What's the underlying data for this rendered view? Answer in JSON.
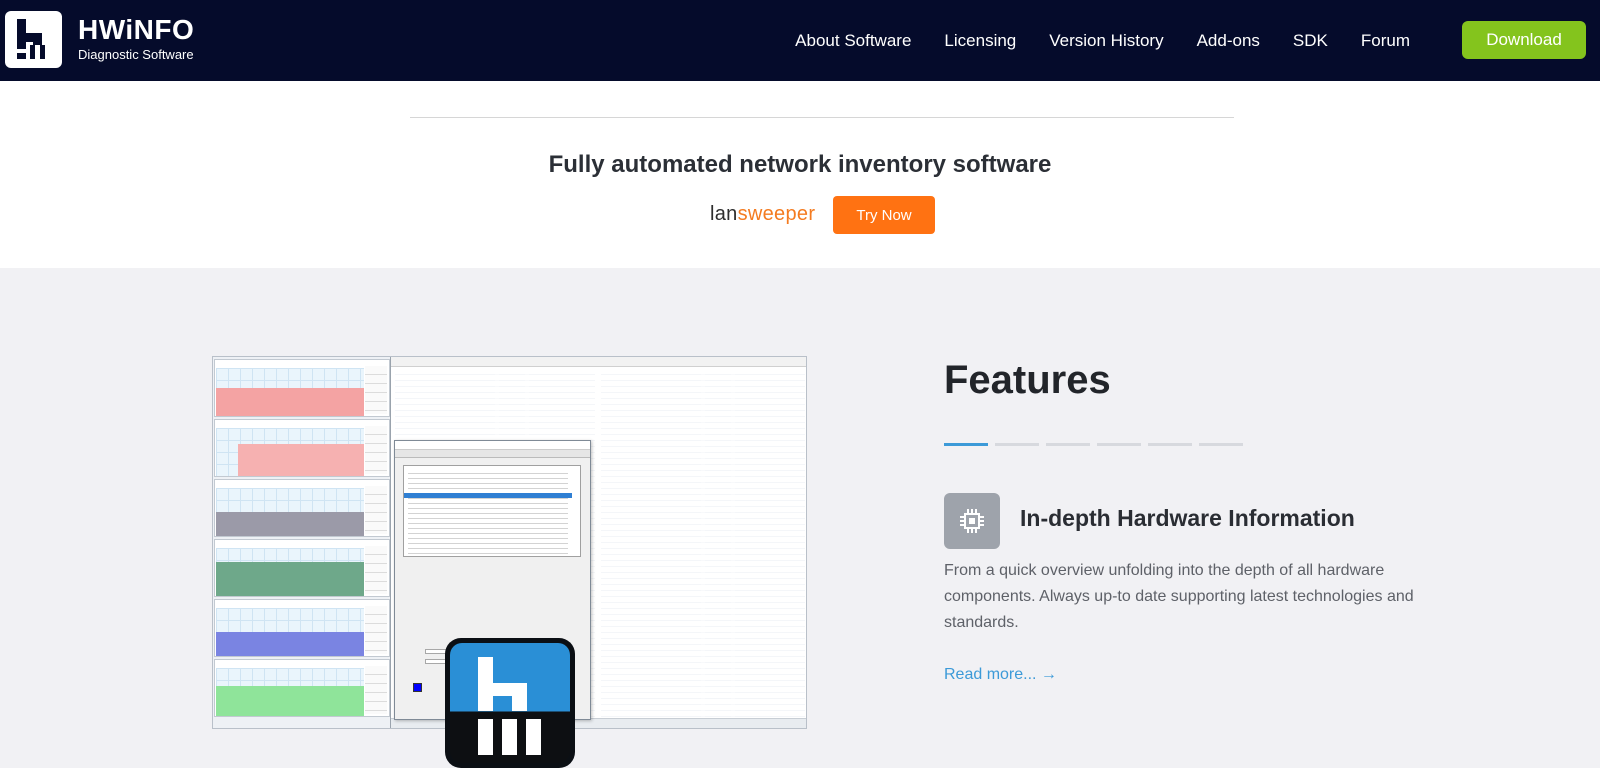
{
  "header": {
    "logo_title": "HWiNFO",
    "logo_subtitle": "Diagnostic Software",
    "nav": [
      "About Software",
      "Licensing",
      "Version History",
      "Add-ons",
      "SDK",
      "Forum"
    ],
    "download_label": "Download"
  },
  "promo": {
    "title": "Fully automated network inventory software",
    "brand_left": "lan",
    "brand_right": "sweeper",
    "try_label": "Try Now"
  },
  "features": {
    "title": "Features",
    "carousel_count": 6,
    "carousel_active": 0,
    "item": {
      "icon": "chip-icon",
      "heading": "In-depth Hardware Information",
      "description": "From a quick overview unfolding into the depth of all hardware components. Always up-to date supporting latest technologies and standards.",
      "read_more": "Read more... →"
    }
  },
  "colors": {
    "header_bg": "#050b2b",
    "download_bg": "#84c41d",
    "try_bg": "#ff7212",
    "section_bg": "#f1f1f4",
    "accent": "#3c9ad8"
  }
}
